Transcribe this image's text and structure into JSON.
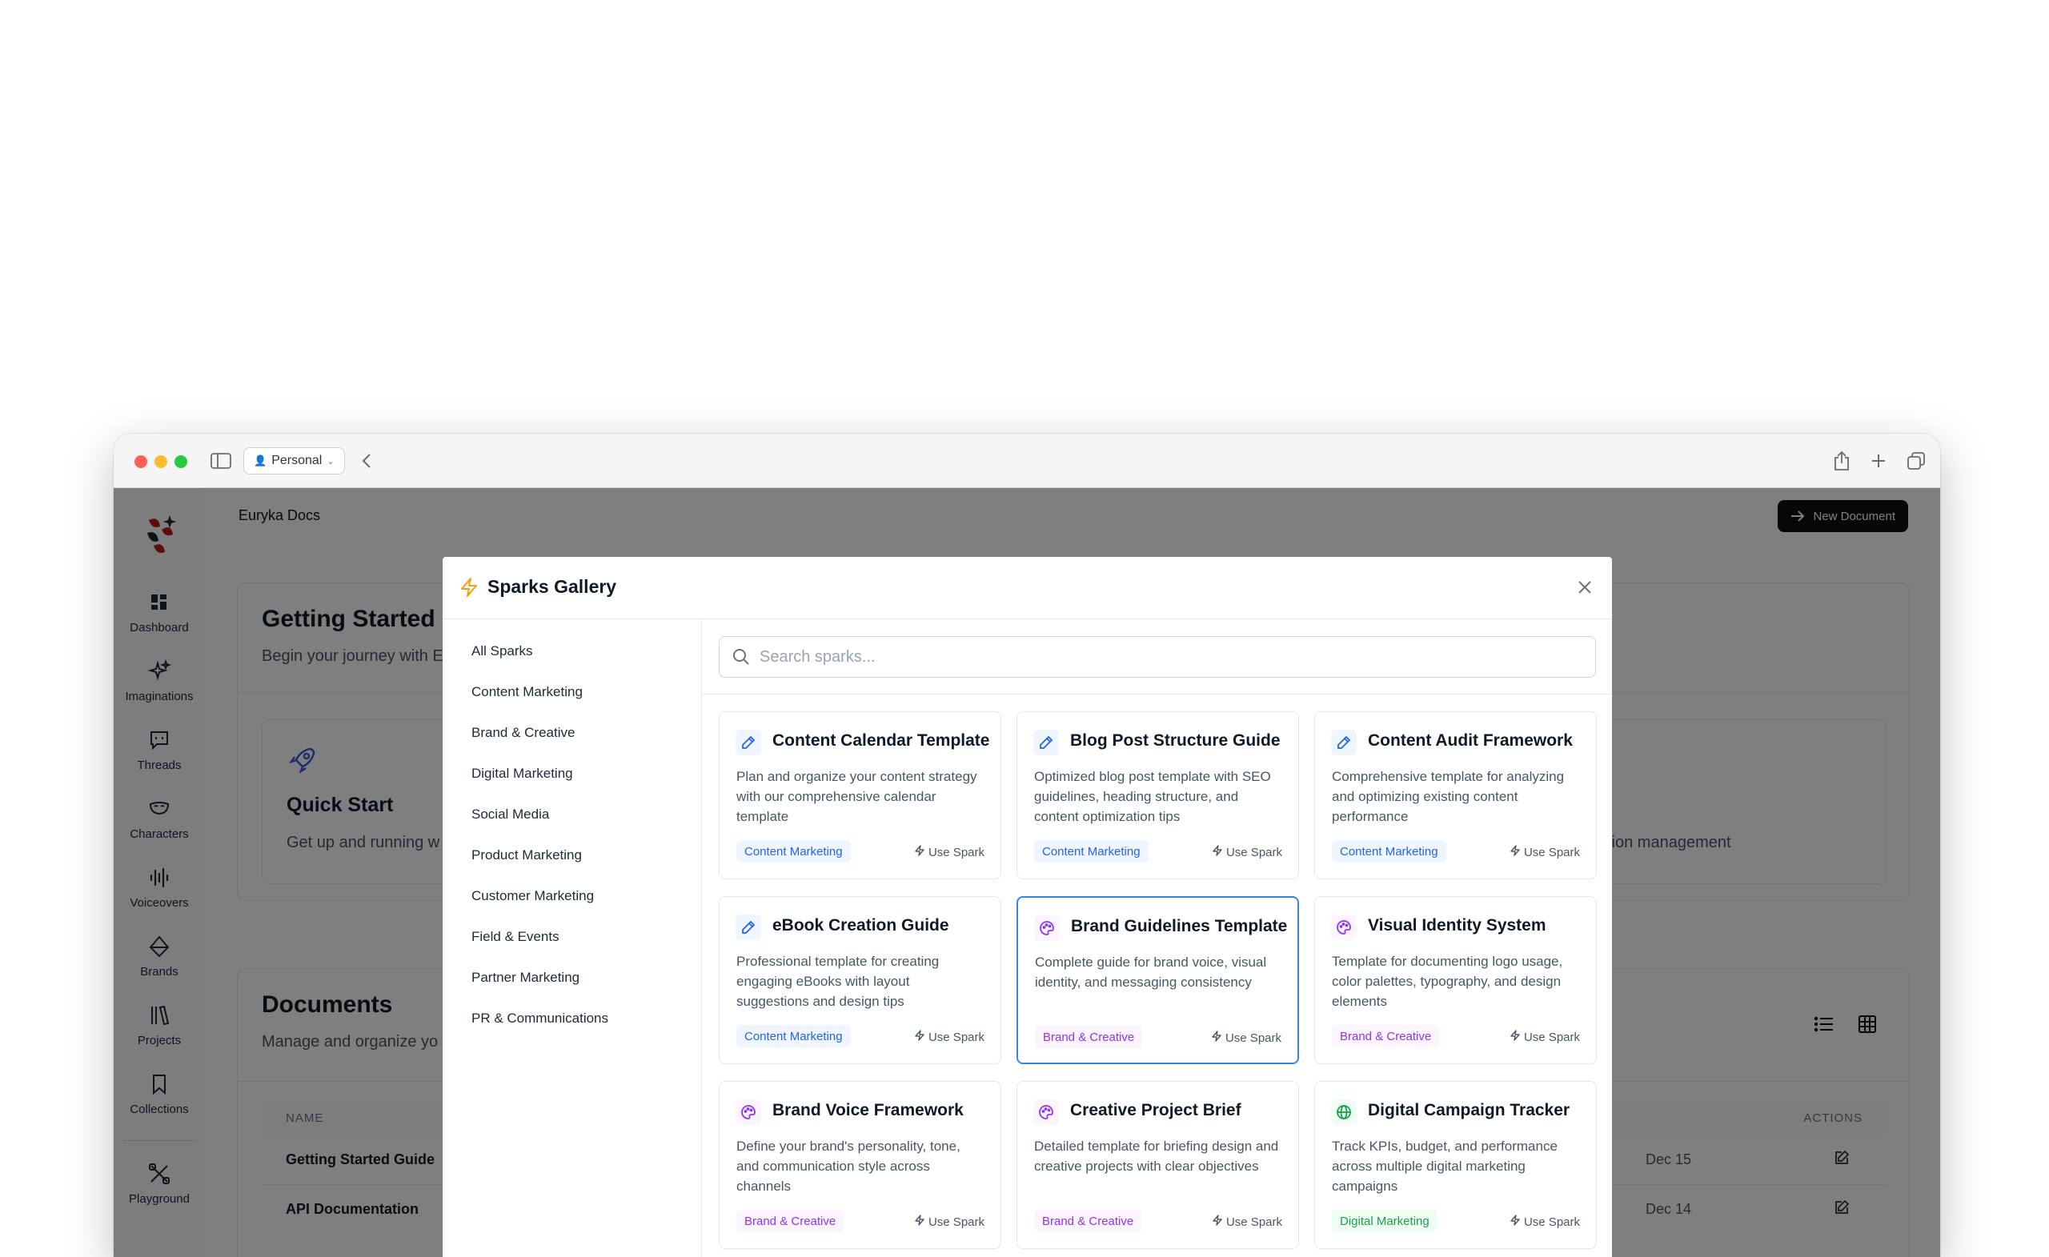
{
  "browser": {
    "profile_label": "Personal"
  },
  "app": {
    "title": "Euryka Docs",
    "new_document_label": "New Document",
    "nav": [
      {
        "label": "Dashboard"
      },
      {
        "label": "Imaginations"
      },
      {
        "label": "Threads"
      },
      {
        "label": "Characters"
      },
      {
        "label": "Voiceovers"
      },
      {
        "label": "Brands"
      },
      {
        "label": "Projects"
      },
      {
        "label": "Collections"
      },
      {
        "label": "Playground"
      }
    ]
  },
  "background": {
    "getting_started_title": "Getting Started",
    "getting_started_sub": "Begin your journey with E",
    "quick_start_title": "Quick Start",
    "quick_start_sub": "Get up and running w",
    "right_card_text": "tion management",
    "documents_title": "Documents",
    "documents_sub": "Manage and organize yo",
    "col_name": "NAME",
    "col_actions": "ACTIONS",
    "rows": [
      {
        "name": "Getting Started Guide",
        "date": "Dec 15"
      },
      {
        "name": "API Documentation",
        "date": "Dec 14"
      }
    ]
  },
  "modal": {
    "title": "Sparks Gallery",
    "search_placeholder": "Search sparks...",
    "categories": [
      "All Sparks",
      "Content Marketing",
      "Brand & Creative",
      "Digital Marketing",
      "Social Media",
      "Product Marketing",
      "Customer Marketing",
      "Field & Events",
      "Partner Marketing",
      "PR & Communications"
    ],
    "use_label": "Use Spark",
    "sparks": [
      {
        "title": "Content Calendar Template",
        "desc": "Plan and organize your content strategy with our comprehensive calendar template",
        "tag": "Content Marketing",
        "kind": "cm",
        "icon": "pencil-icon"
      },
      {
        "title": "Blog Post Structure Guide",
        "desc": "Optimized blog post template with SEO guidelines, heading structure, and content optimization tips",
        "tag": "Content Marketing",
        "kind": "cm",
        "icon": "pencil-icon"
      },
      {
        "title": "Content Audit Framework",
        "desc": "Comprehensive template for analyzing and optimizing existing content performance",
        "tag": "Content Marketing",
        "kind": "cm",
        "icon": "pencil-icon"
      },
      {
        "title": "eBook Creation Guide",
        "desc": "Professional template for creating engaging eBooks with layout suggestions and design tips",
        "tag": "Content Marketing",
        "kind": "cm",
        "icon": "pencil-icon"
      },
      {
        "title": "Brand Guidelines Template",
        "desc": "Complete guide for brand voice, visual identity, and messaging consistency",
        "tag": "Brand & Creative",
        "kind": "bc",
        "icon": "palette-icon"
      },
      {
        "title": "Visual Identity System",
        "desc": "Template for documenting logo usage, color palettes, typography, and design elements",
        "tag": "Brand & Creative",
        "kind": "bc",
        "icon": "palette-icon"
      },
      {
        "title": "Brand Voice Framework",
        "desc": "Define your brand's personality, tone, and communication style across channels",
        "tag": "Brand & Creative",
        "kind": "bc",
        "icon": "palette-icon"
      },
      {
        "title": "Creative Project Brief",
        "desc": "Detailed template for briefing design and creative projects with clear objectives",
        "tag": "Brand & Creative",
        "kind": "bc",
        "icon": "palette-icon"
      },
      {
        "title": "Digital Campaign Tracker",
        "desc": "Track KPIs, budget, and performance across multiple digital marketing campaigns",
        "tag": "Digital Marketing",
        "kind": "dm",
        "icon": "globe-icon"
      }
    ]
  },
  "colors": {
    "accent_blue": "#2563eb",
    "accent_purple": "#9333ea",
    "accent_green": "#16a34a",
    "spark_bolt": "#f59e0b"
  }
}
